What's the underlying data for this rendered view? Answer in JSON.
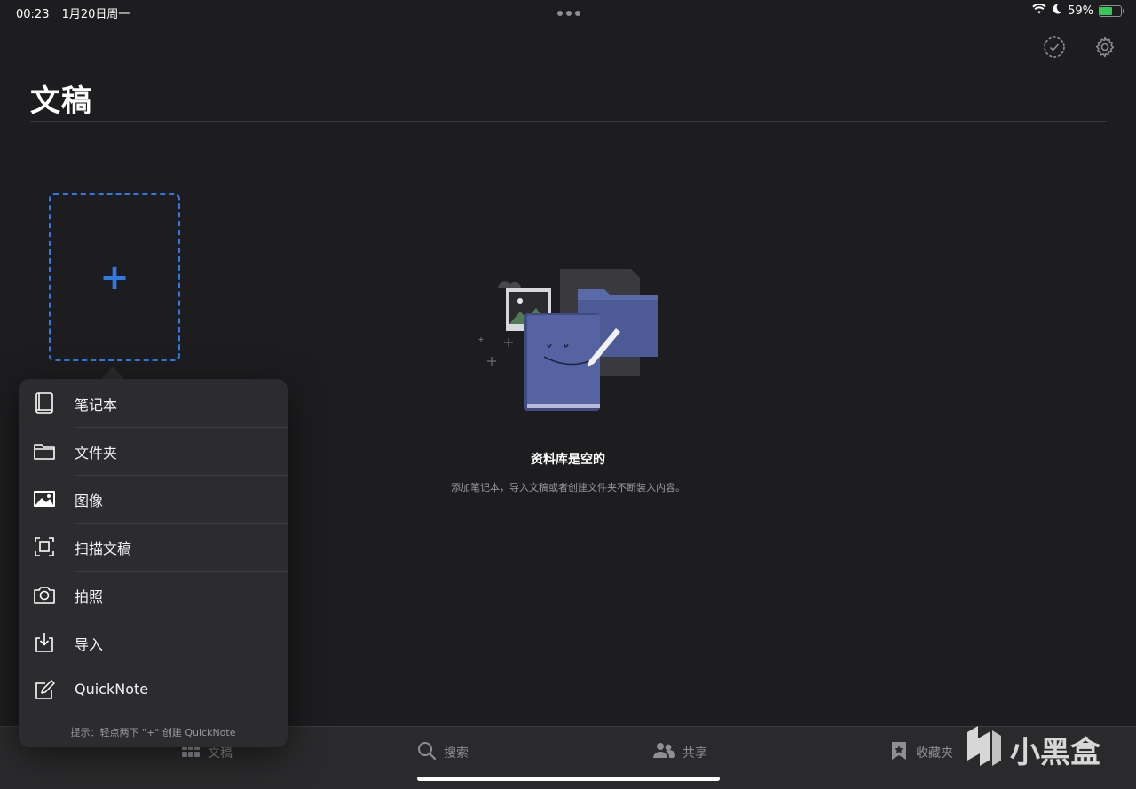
{
  "status_bar": {
    "time": "00:23",
    "date": "1月20日周一",
    "battery_text": "59%",
    "battery_level": 0.59,
    "battery_color": "#34c759"
  },
  "toolbar": {
    "select_icon": "checkmark-circle-icon",
    "settings_icon": "gear-icon"
  },
  "page": {
    "title": "文稿",
    "add_symbol": "+"
  },
  "empty_state": {
    "title": "资料库是空的",
    "description": "添加笔记本，导入文稿或者创建文件夹不断装入内容。"
  },
  "menu": {
    "items": [
      {
        "label": "笔记本",
        "icon": "notebook-icon"
      },
      {
        "label": "文件夹",
        "icon": "folder-icon"
      },
      {
        "label": "图像",
        "icon": "image-icon"
      },
      {
        "label": "扫描文稿",
        "icon": "scan-icon"
      },
      {
        "label": "拍照",
        "icon": "camera-icon"
      },
      {
        "label": "导入",
        "icon": "import-icon"
      },
      {
        "label": "QuickNote",
        "icon": "quicknote-icon"
      }
    ],
    "hint": "提示：轻点两下 \"+\" 创建 QuickNote"
  },
  "tabs": [
    {
      "label": "文稿",
      "icon": "grid-icon"
    },
    {
      "label": "搜索",
      "icon": "search-icon"
    },
    {
      "label": "共享",
      "icon": "people-icon"
    },
    {
      "label": "收藏夹",
      "icon": "bookmark-star-icon"
    }
  ],
  "watermark": {
    "text": "小黑盒"
  },
  "colors": {
    "accent": "#2f7ae5",
    "background": "#1d1d1f",
    "popover": "#2c2c2e"
  }
}
